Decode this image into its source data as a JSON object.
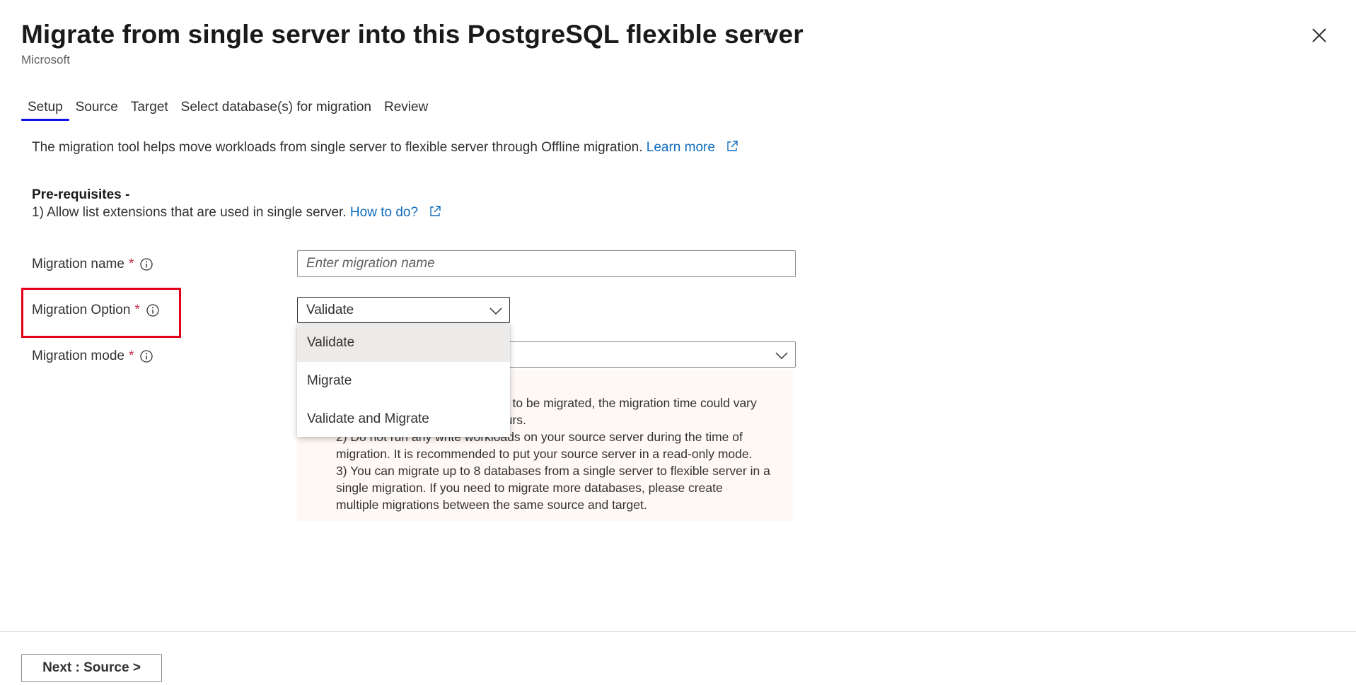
{
  "header": {
    "title": "Migrate from single server into this PostgreSQL flexible server",
    "subtitle": "Microsoft",
    "more_label": "···",
    "close_icon": "close-icon"
  },
  "tabs": [
    {
      "label": "Setup",
      "active": true
    },
    {
      "label": "Source",
      "active": false
    },
    {
      "label": "Target",
      "active": false
    },
    {
      "label": "Select database(s) for migration",
      "active": false
    },
    {
      "label": "Review",
      "active": false
    }
  ],
  "intro": {
    "text": "The migration tool helps move workloads from single server to flexible server through Offline migration.",
    "link": "Learn more"
  },
  "prereq": {
    "title": "Pre-requisites -",
    "item_text": "1) Allow list extensions that are used in single server.",
    "item_link": "How to do?"
  },
  "form": {
    "migration_name": {
      "label": "Migration name",
      "required": "*",
      "placeholder": "Enter migration name"
    },
    "migration_option": {
      "label": "Migration Option",
      "required": "*",
      "value": "Validate"
    },
    "migration_mode": {
      "label": "Migration mode",
      "required": "*"
    }
  },
  "dropdown": {
    "options": [
      "Validate",
      "Migrate",
      "Validate and Migrate"
    ],
    "selected": "Validate"
  },
  "warning": {
    "line1_partial": "ta to be migrated, the migration time could vary",
    "line2_partial": "ours.",
    "line3_partial": "2) Do not run any write workloads on your source server during the time of",
    "line4": "migration. It is recommended to put your source server in a read-only mode.",
    "line5": "3) You can migrate up to 8 databases from a single server to flexible server in a",
    "line6": "single migration. If you need to migrate more databases, please create",
    "line7": "multiple migrations between the same source and target."
  },
  "footer": {
    "next_label": "Next : Source >"
  },
  "colors": {
    "accent": "#0f0fe8",
    "link": "#0f6cbd",
    "highlight": "#e3001b",
    "required": "#c4314b",
    "warning_bg": "#fff9f5"
  }
}
